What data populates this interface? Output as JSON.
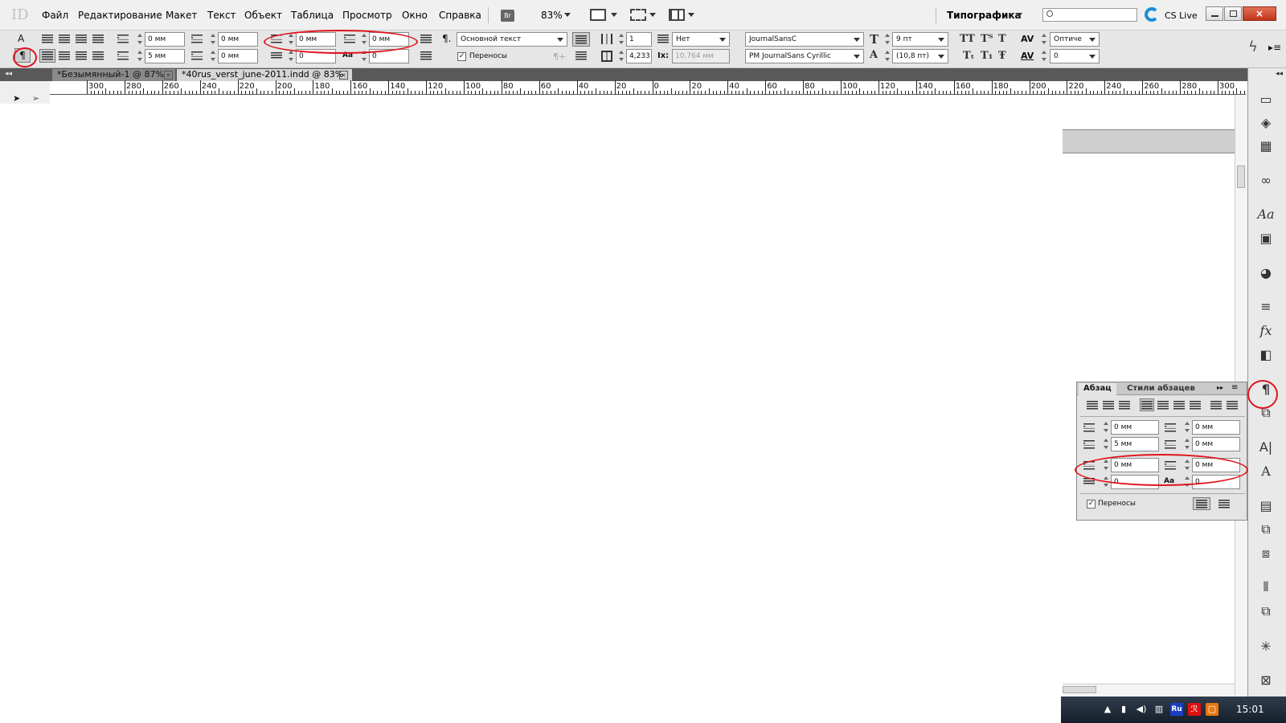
{
  "app": {
    "logo": "ID",
    "zoom": "83%",
    "bridge": "Br",
    "workspace": "Типографика",
    "cs_live": "CS Live",
    "search_placeholder": ""
  },
  "menu": [
    "Файл",
    "Редактирование",
    "Макет",
    "Текст",
    "Объект",
    "Таблица",
    "Просмотр",
    "Окно",
    "Справка"
  ],
  "control": {
    "char_mode": "A",
    "para_mode": "¶",
    "left_indent": "0 мм",
    "first_line_indent": "5 мм",
    "right_indent": "0 мм",
    "last_line_indent": "0 мм",
    "space_before": "0 мм",
    "space_after": "0 мм",
    "dropcap_lines": "0",
    "dropcap_chars": "0",
    "para_style": "Основной текст",
    "hyphenation_label": "Переносы",
    "columns": "1",
    "rule_none": "Нет",
    "column_width": "4,233",
    "baseline": "10,764 мм",
    "font_family": "JournalSansC",
    "font_style": "PM JournalSans Cyrillic",
    "font_size": "9 пт",
    "leading": "(10,8 пт)",
    "tracking_mode": "Оптиче",
    "tracking": "0",
    "caps_all": "TT",
    "caps_small": "Tᵀ",
    "caps_t": "T",
    "sub": "Tₜ",
    "super": "T₁",
    "strike": "Ŧ"
  },
  "tabs": [
    {
      "label": "*Безымянный-1 @ 87%",
      "close": "×"
    },
    {
      "label": "*40rus_verst_june-2011.indd @ 83%",
      "close": "×"
    }
  ],
  "ruler": [
    "300",
    "280",
    "260",
    "240",
    "220",
    "200",
    "180",
    "160",
    "140",
    "120",
    "100",
    "80",
    "60",
    "40",
    "20",
    "0",
    "20",
    "40",
    "60",
    "80",
    "100",
    "120",
    "140",
    "160",
    "180",
    "200",
    "220",
    "240",
    "260",
    "280",
    "300"
  ],
  "panel": {
    "tab_paragraph": "Абзац",
    "tab_styles": "Стили абзацев",
    "left_indent": "0 мм",
    "right_indent": "0 мм",
    "first_line_indent": "5 мм",
    "last_line_indent": "0 мм",
    "space_before": "0 мм",
    "space_after": "0 мм",
    "dropcap_lines": "0",
    "dropcap_chars": "0",
    "hyphenation_label": "Переносы"
  },
  "taskbar": {
    "lang": "Ru",
    "time": "15:01"
  },
  "colors": {
    "annotation": "#e0141e",
    "menubar": "#f0f0f0",
    "tabbar": "#595959"
  }
}
